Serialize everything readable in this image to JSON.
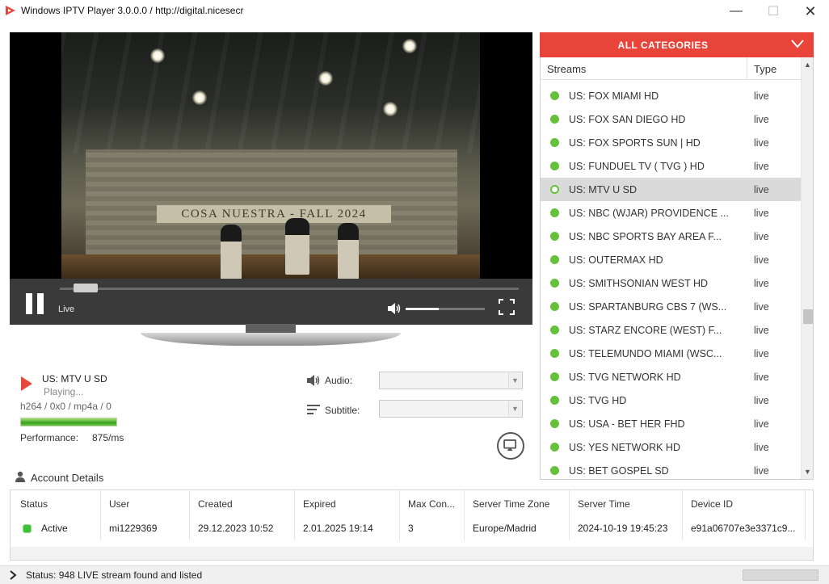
{
  "window": {
    "title": "Windows IPTV Player 3.0.0.0 / http://digital.nicesecr",
    "minimize_glyph": "—",
    "maximize_glyph": "☐",
    "close_glyph": "✕"
  },
  "player": {
    "overlay_text": "COSA NUESTRA - FALL 2024",
    "live_label": "Live",
    "seek_position": 0.03,
    "volume_level": 0.42
  },
  "now_playing": {
    "channel": "US: MTV U SD",
    "state": "Playing...",
    "codec": "h264 / 0x0 / mp4a / 0",
    "performance_fill": 1.0,
    "performance_label": "Performance:",
    "performance_value": "875/ms"
  },
  "tracks": {
    "audio_label": "Audio:",
    "subtitle_label": "Subtitle:",
    "audio_value": "",
    "subtitle_value": ""
  },
  "categories": {
    "title": "ALL CATEGORIES",
    "col_streams": "Streams",
    "col_type": "Type",
    "streams": [
      {
        "name": "US: FOX MIAMI HD",
        "type": "live",
        "selected": false
      },
      {
        "name": "US: FOX SAN DIEGO HD",
        "type": "live",
        "selected": false
      },
      {
        "name": "US: FOX SPORTS SUN | HD",
        "type": "live",
        "selected": false
      },
      {
        "name": "US: FUNDUEL TV ( TVG ) HD",
        "type": "live",
        "selected": false
      },
      {
        "name": "US: MTV U SD",
        "type": "live",
        "selected": true
      },
      {
        "name": "US: NBC (WJAR) PROVIDENCE ...",
        "type": "live",
        "selected": false
      },
      {
        "name": "US: NBC SPORTS BAY AREA F...",
        "type": "live",
        "selected": false
      },
      {
        "name": "US: OUTERMAX HD",
        "type": "live",
        "selected": false
      },
      {
        "name": "US: SMITHSONIAN WEST HD",
        "type": "live",
        "selected": false
      },
      {
        "name": "US: SPARTANBURG CBS 7 (WS...",
        "type": "live",
        "selected": false
      },
      {
        "name": "US: STARZ ENCORE (WEST) F...",
        "type": "live",
        "selected": false
      },
      {
        "name": "US: TELEMUNDO MIAMI (WSC...",
        "type": "live",
        "selected": false
      },
      {
        "name": "US: TVG NETWORK HD",
        "type": "live",
        "selected": false
      },
      {
        "name": "US: TVG HD",
        "type": "live",
        "selected": false
      },
      {
        "name": "US: USA - BET HER FHD",
        "type": "live",
        "selected": false
      },
      {
        "name": "US: YES NETWORK HD",
        "type": "live",
        "selected": false
      },
      {
        "name": "US: BET GOSPEL SD",
        "type": "live",
        "selected": false
      }
    ]
  },
  "account": {
    "title": "Account Details",
    "headers": [
      "Status",
      "User",
      "Created",
      "Expired",
      "Max Con...",
      "Server Time Zone",
      "Server Time",
      "Device ID"
    ],
    "values": [
      "Active",
      "mi1229369",
      "29.12.2023 10:52",
      "2.01.2025 19:14",
      "3",
      "Europe/Madrid",
      "2024-10-19 19:45:23",
      "e91a06707e3e3371c9..."
    ]
  },
  "statusbar": {
    "text": "Status: 948 LIVE stream found and listed"
  },
  "colors": {
    "accent": "#e8443a",
    "live_dot": "#66c13a",
    "selected_row": "#dadada"
  },
  "icons": {
    "app": "play-triangle-icon",
    "pause": "pause-icon",
    "volume": "speaker-icon",
    "fullscreen": "fullscreen-icon",
    "audio": "speaker-icon",
    "subtitle": "subtitle-lines-icon",
    "cast": "cast-icon",
    "category_toggle": "chevron-down-icon",
    "account": "user-icon",
    "status": "chevron-right-icon"
  }
}
